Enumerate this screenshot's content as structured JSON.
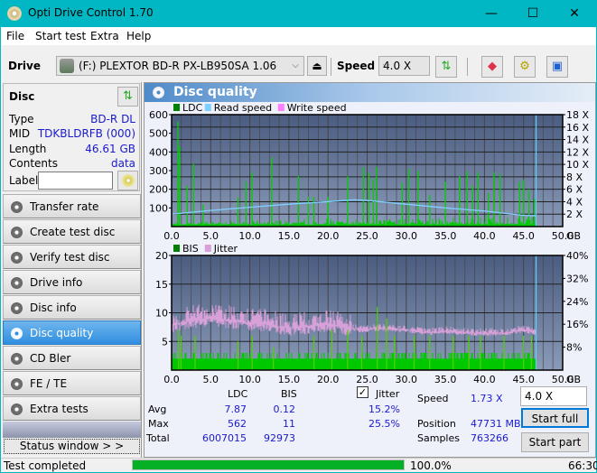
{
  "window": {
    "title": "Opti Drive Control 1.70",
    "minimize": "—",
    "maximize": "☐",
    "close": "✕"
  },
  "menu": [
    "File",
    "Start test",
    "Extra",
    "Help"
  ],
  "toolbar": {
    "drive_label": "Drive",
    "drive_value": "(F:)  PLEXTOR BD-R  PX-LB950SA 1.06",
    "speed_label": "Speed",
    "speed_value": "4.0 X"
  },
  "disc": {
    "header": "Disc",
    "rows": [
      {
        "key": "Type",
        "value": "BD-R DL"
      },
      {
        "key": "MID",
        "value": "TDKBLDRFB (000)"
      },
      {
        "key": "Length",
        "value": "46.61 GB"
      },
      {
        "key": "Contents",
        "value": "data"
      }
    ],
    "label_key": "Label",
    "label_value": ""
  },
  "nav": [
    {
      "label": "Transfer rate",
      "active": false
    },
    {
      "label": "Create test disc",
      "active": false
    },
    {
      "label": "Verify test disc",
      "active": false
    },
    {
      "label": "Drive info",
      "active": false
    },
    {
      "label": "Disc info",
      "active": false
    },
    {
      "label": "Disc quality",
      "active": true
    },
    {
      "label": "CD Bler",
      "active": false
    },
    {
      "label": "FE / TE",
      "active": false
    },
    {
      "label": "Extra tests",
      "active": false
    }
  ],
  "status_window_button": "Status window > >",
  "panel": {
    "title": "Disc quality"
  },
  "chart_data": [
    {
      "type": "bar",
      "title": "",
      "legend": [
        "LDC",
        "Read speed",
        "Write speed"
      ],
      "legend_colors": [
        "#008000",
        "#7fd0ff",
        "#ff80ff"
      ],
      "x_ticks": [
        "0.0",
        "5.0",
        "10.0",
        "15.0",
        "20.0",
        "25.0",
        "30.0",
        "35.0",
        "40.0",
        "45.0",
        "50.0"
      ],
      "x_unit": "GB",
      "xlim": [
        0,
        50
      ],
      "y_ticks": [
        "100",
        "200",
        "300",
        "400",
        "500",
        "600"
      ],
      "ylim": [
        0,
        600
      ],
      "y2_ticks": [
        "2 X",
        "4 X",
        "6 X",
        "8 X",
        "10 X",
        "12 X",
        "14 X",
        "16 X",
        "18 X"
      ],
      "y2lim": [
        0,
        18
      ],
      "ldc_peaks": [
        [
          0.8,
          562
        ],
        [
          1.0,
          430
        ],
        [
          2.0,
          220
        ],
        [
          2.8,
          335
        ],
        [
          4.0,
          120
        ],
        [
          8.5,
          155
        ],
        [
          9.5,
          240
        ],
        [
          10.3,
          290
        ],
        [
          12.8,
          370
        ],
        [
          16.2,
          275
        ],
        [
          17.5,
          160
        ],
        [
          18.2,
          160
        ],
        [
          20.0,
          160
        ],
        [
          22.5,
          270
        ],
        [
          24.5,
          320
        ],
        [
          25.2,
          290
        ],
        [
          25.8,
          255
        ],
        [
          26.2,
          320
        ],
        [
          29.5,
          235
        ],
        [
          30.3,
          310
        ],
        [
          31.5,
          300
        ],
        [
          33.0,
          170
        ],
        [
          35.0,
          240
        ],
        [
          36.8,
          270
        ],
        [
          37.8,
          295
        ],
        [
          38.5,
          220
        ],
        [
          39.2,
          290
        ],
        [
          40.5,
          180
        ],
        [
          41.2,
          290
        ],
        [
          42.0,
          280
        ],
        [
          44.5,
          240
        ],
        [
          45.0,
          250
        ],
        [
          45.7,
          200
        ],
        [
          46.4,
          150
        ]
      ],
      "read_speed": [
        [
          0,
          2.0
        ],
        [
          5,
          2.6
        ],
        [
          10,
          3.1
        ],
        [
          15,
          3.6
        ],
        [
          20,
          4.0
        ],
        [
          23.3,
          4.3
        ],
        [
          25,
          4.2
        ],
        [
          30,
          3.6
        ],
        [
          35,
          3.0
        ],
        [
          40,
          2.5
        ],
        [
          45,
          1.8
        ],
        [
          46.6,
          1.73
        ]
      ],
      "end_marker_gb": 46.6
    },
    {
      "type": "bar",
      "title": "",
      "legend": [
        "BIS",
        "Jitter"
      ],
      "legend_colors": [
        "#008000",
        "#d8a0d8"
      ],
      "x_ticks": [
        "0.0",
        "5.0",
        "10.0",
        "15.0",
        "20.0",
        "25.0",
        "30.0",
        "35.0",
        "40.0",
        "45.0",
        "50.0"
      ],
      "x_unit": "GB",
      "xlim": [
        0,
        50
      ],
      "y_ticks": [
        "5",
        "10",
        "15",
        "20"
      ],
      "ylim": [
        0,
        20
      ],
      "y2_ticks": [
        "8%",
        "16%",
        "24%",
        "32%",
        "40%"
      ],
      "y2lim": [
        0,
        40
      ],
      "bis_peaks": [
        [
          0.9,
          7
        ],
        [
          1.2,
          6
        ],
        [
          3.0,
          6
        ],
        [
          8.5,
          5
        ],
        [
          10.3,
          6
        ],
        [
          13.0,
          4
        ],
        [
          18.2,
          6
        ],
        [
          20.5,
          7
        ],
        [
          22.5,
          7
        ],
        [
          24.3,
          6
        ],
        [
          26.3,
          11
        ],
        [
          27.5,
          9
        ],
        [
          28.5,
          6
        ],
        [
          31.0,
          6
        ],
        [
          33.0,
          6
        ],
        [
          36.0,
          6
        ],
        [
          38.0,
          6
        ],
        [
          39.5,
          6
        ],
        [
          42.5,
          6
        ],
        [
          45.0,
          6
        ],
        [
          46.0,
          6
        ]
      ],
      "jitter_pct": [
        [
          0,
          15.5
        ],
        [
          2,
          17
        ],
        [
          5,
          18
        ],
        [
          8,
          17
        ],
        [
          10,
          16.5
        ],
        [
          12,
          16
        ],
        [
          15,
          14.5
        ],
        [
          18,
          15.5
        ],
        [
          20,
          16
        ],
        [
          22,
          15
        ],
        [
          24,
          14
        ],
        [
          26,
          14.5
        ],
        [
          30,
          14
        ],
        [
          33,
          13
        ],
        [
          35,
          13.5
        ],
        [
          38,
          13
        ],
        [
          40,
          12.8
        ],
        [
          43,
          13
        ],
        [
          45,
          14
        ],
        [
          46.6,
          13
        ]
      ]
    }
  ],
  "stats": {
    "col_ldc": "LDC",
    "col_bis": "BIS",
    "jitter_label": "Jitter",
    "jitter_checked": true,
    "rows": [
      {
        "label": "Avg",
        "ldc": "7.87",
        "bis": "0.12",
        "jitter": "15.2%"
      },
      {
        "label": "Max",
        "ldc": "562",
        "bis": "11",
        "jitter": "25.5%"
      },
      {
        "label": "Total",
        "ldc": "6007015",
        "bis": "92973",
        "jitter": ""
      }
    ],
    "speed_label": "Speed",
    "speed_value": "1.73 X",
    "position_label": "Position",
    "position_value": "47731 MB",
    "samples_label": "Samples",
    "samples_value": "763266",
    "speed_select": "4.0 X",
    "start_full": "Start full",
    "start_part": "Start part"
  },
  "statusbar": {
    "text": "Test completed",
    "progress_pct": 100,
    "progress_text": "100.0%",
    "time": "66:30"
  }
}
